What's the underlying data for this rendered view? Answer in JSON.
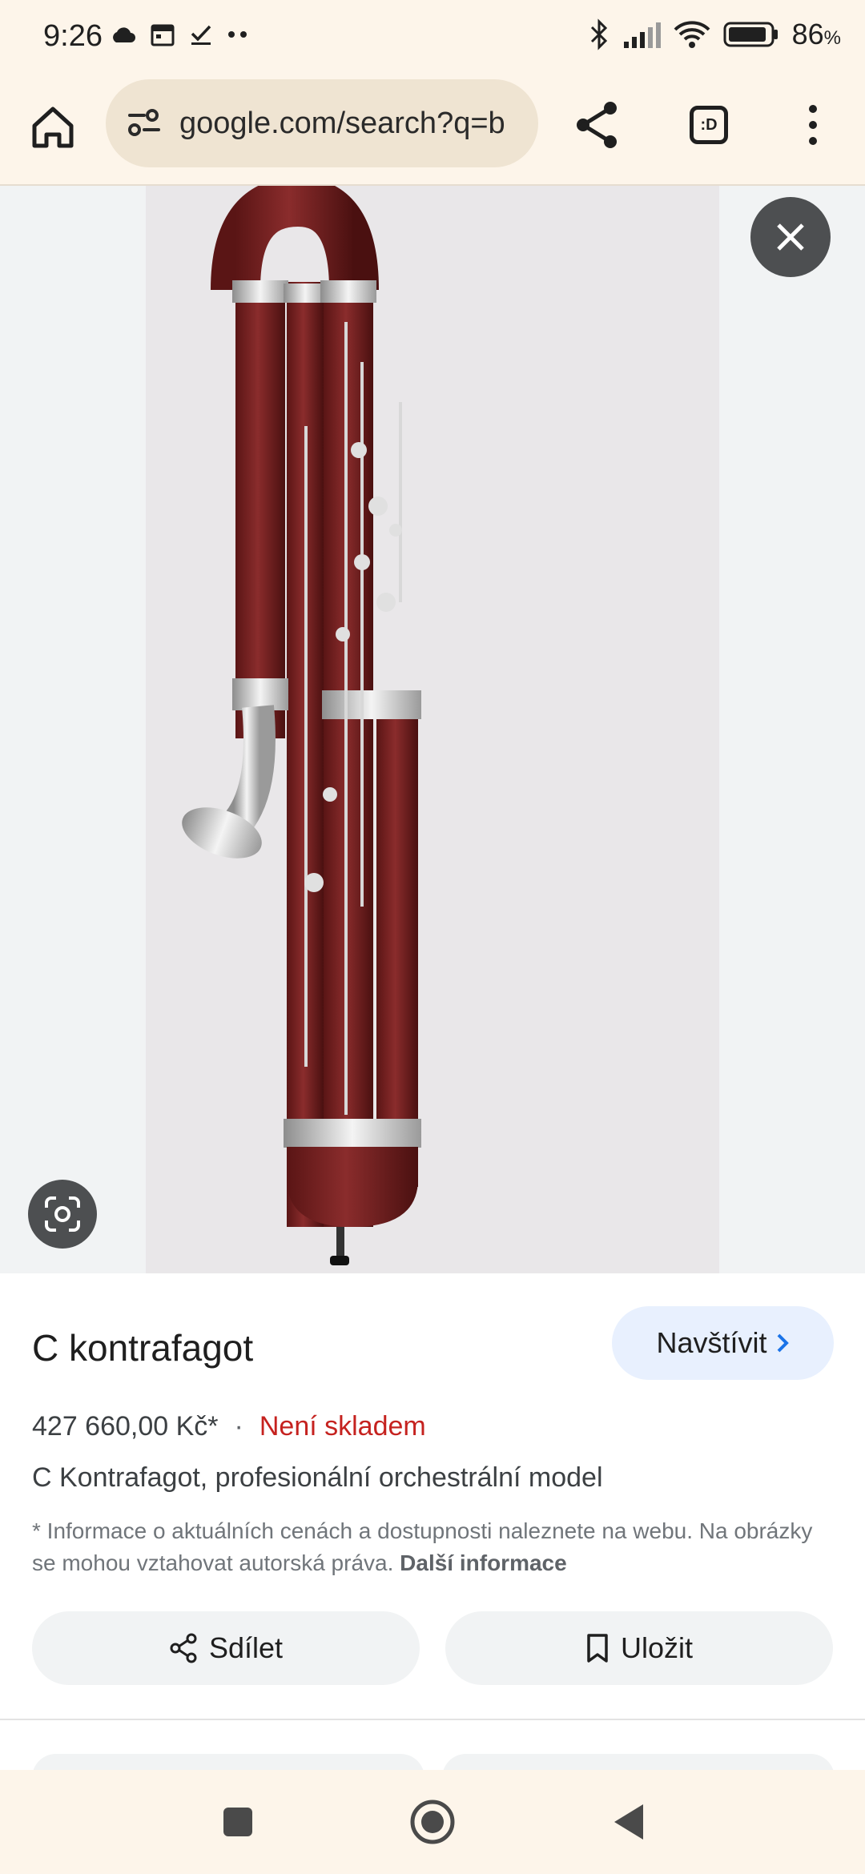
{
  "status_bar": {
    "time": "9:26",
    "battery_percent": "86",
    "battery_unit": "%",
    "left_icons": [
      "cloud-icon",
      "calendar-icon",
      "check-icon",
      "more-dots-icon"
    ],
    "right_icons": [
      "bluetooth-icon",
      "signal-icon",
      "wifi-icon",
      "battery-icon"
    ]
  },
  "browser": {
    "url": "google.com/search?q=b",
    "tab_count_label": ":D"
  },
  "viewer": {
    "image_subject": "contrabassoon-photo"
  },
  "result": {
    "title": "C kontrafagot",
    "visit_label": "Navštívit",
    "price": "427 660,00 Kč*",
    "separator": "·",
    "stock_status": "Není skladem",
    "description": "C Kontrafagot, profesionální orchestrální model",
    "disclaimer": "* Informace o aktuálních cenách a dostupnosti naleznete na webu. Na obrázky se mohou vztahovat autorská práva.",
    "more_info_label": "Další informace",
    "share_label": "Sdílet",
    "save_label": "Uložit"
  },
  "colors": {
    "chrome_bg": "#fdf5ea",
    "url_bg": "#efe4d2",
    "accent_blue": "#1a73e8",
    "stock_red": "#c5221f",
    "visit_bg": "#e8f0fe"
  }
}
